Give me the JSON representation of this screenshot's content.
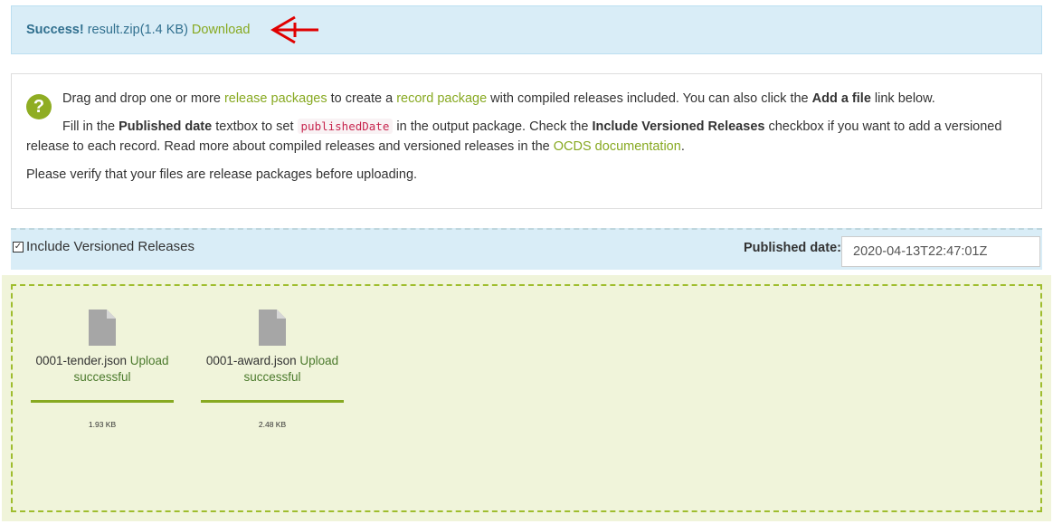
{
  "success": {
    "strong": "Success!",
    "file": "result.zip(1.4 KB)",
    "download": "Download"
  },
  "info": {
    "p1": {
      "t1": "Drag and drop one or more ",
      "l1": "release packages",
      "t2": " to create a ",
      "l2": "record package",
      "t3": " with compiled releases included. You can also click the ",
      "b1": "Add a file",
      "t4": " link below."
    },
    "p2": {
      "t1": "Fill in the ",
      "b1": "Published date",
      "t2": " textbox to set ",
      "code": "publishedDate",
      "t3": " in the output package. Check the ",
      "b2": "Include Versioned Releases",
      "t4": " checkbox if you want to add a versioned release to each record. Read more about compiled releases and versioned releases in the ",
      "l1": "OCDS documentation",
      "t5": "."
    },
    "p3": "Please verify that your files are release packages before uploading."
  },
  "options": {
    "checkbox_label": "Include Versioned Releases",
    "checkbox_checked": true,
    "checkbox_mark": "✓",
    "published_label": "Published date:",
    "published_value": "2020-04-13T22:47:01Z"
  },
  "files": [
    {
      "name": "0001-tender.json",
      "status": "Upload successful",
      "size": "1.93 KB",
      "icon": "file-icon"
    },
    {
      "name": "0001-award.json",
      "status": "Upload successful",
      "size": "2.48 KB",
      "icon": "file-icon"
    }
  ],
  "colors": {
    "accent_green": "#87a921",
    "info_bg": "#d9edf7",
    "dropzone_bg": "#f0f4da",
    "arrow_red": "#e00000"
  }
}
